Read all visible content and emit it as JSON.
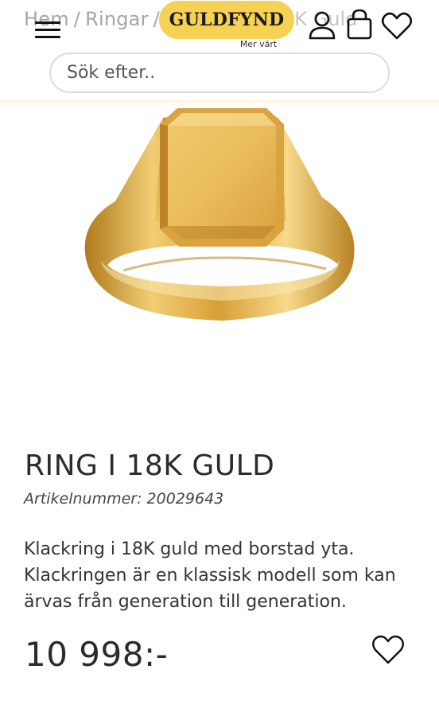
{
  "header": {
    "breadcrumb": {
      "home": "Hem",
      "category": "Ringar",
      "separator": "/",
      "current_visible": "8K Guld"
    },
    "logo": {
      "text": "GULDFYND",
      "tagline": "Mer värt",
      "color": "#f5d253"
    },
    "icons": [
      "menu-icon",
      "user-icon",
      "bag-icon",
      "heart-icon"
    ],
    "search": {
      "placeholder": "Sök efter.."
    }
  },
  "product": {
    "title": "RING I 18K GULD",
    "sku": "Artikelnummer: 20029643",
    "description": "Klackring i 18K guld med borstad yta. Klackringen är en klassisk modell som kan ärvas från generation till generation.",
    "price": "10 998:-",
    "image": "signet-ring-gold",
    "gold_color": "#e3b44a"
  }
}
